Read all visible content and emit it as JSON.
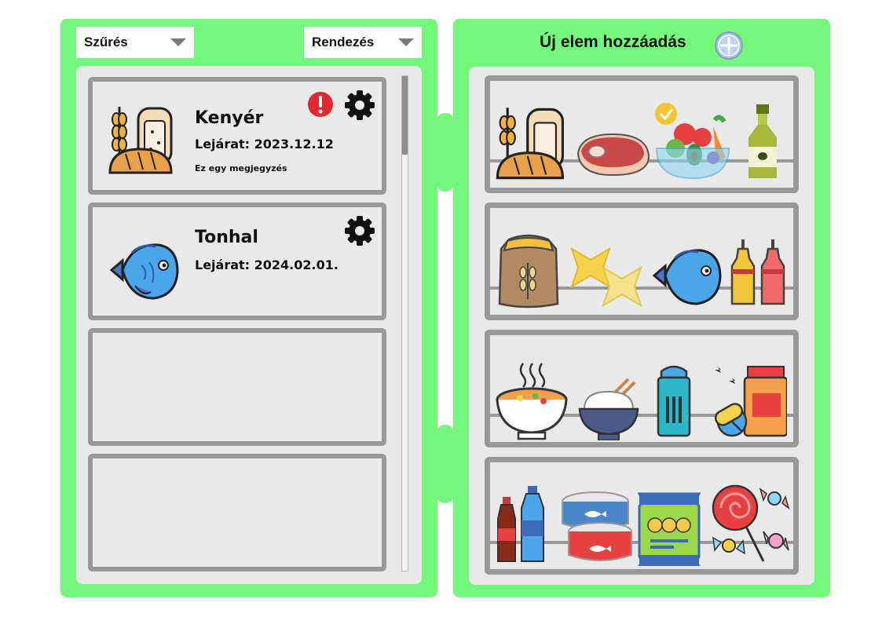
{
  "left": {
    "filter_label": "Szűrés",
    "sort_label": "Rendezés",
    "cards": [
      {
        "title": "Kenyér",
        "expiry": "Lejárat: 2023.12.12",
        "note": "Ez egy megjegyzés",
        "icon": "bread-icon",
        "alert": true
      },
      {
        "title": "Tonhal",
        "expiry": "Lejárat: 2024.02.01.",
        "icon": "fish-icon",
        "alert": false
      },
      {
        "empty": true
      },
      {
        "empty": true
      }
    ]
  },
  "right": {
    "title": "Új elem hozzáadás",
    "add_icon": "plus-circle-icon",
    "shelves": [
      [
        "bread-icon",
        "meat-icon",
        "vegetables-icon",
        "oil-bottle-icon"
      ],
      [
        "flour-sack-icon",
        "pasta-icon",
        "fish-icon",
        "sauce-bottles-icon"
      ],
      [
        "soup-bowl-icon",
        "rice-bowl-icon",
        "salt-shaker-icon",
        "pills-icon"
      ],
      [
        "drinks-icon",
        "canned-fish-icon",
        "snack-bag-icon",
        "candy-icon"
      ]
    ]
  },
  "colors": {
    "panel": "#74f87c",
    "inner": "#e8e8e8",
    "shelf_border": "#9a9797",
    "alert": "#e0282e"
  }
}
